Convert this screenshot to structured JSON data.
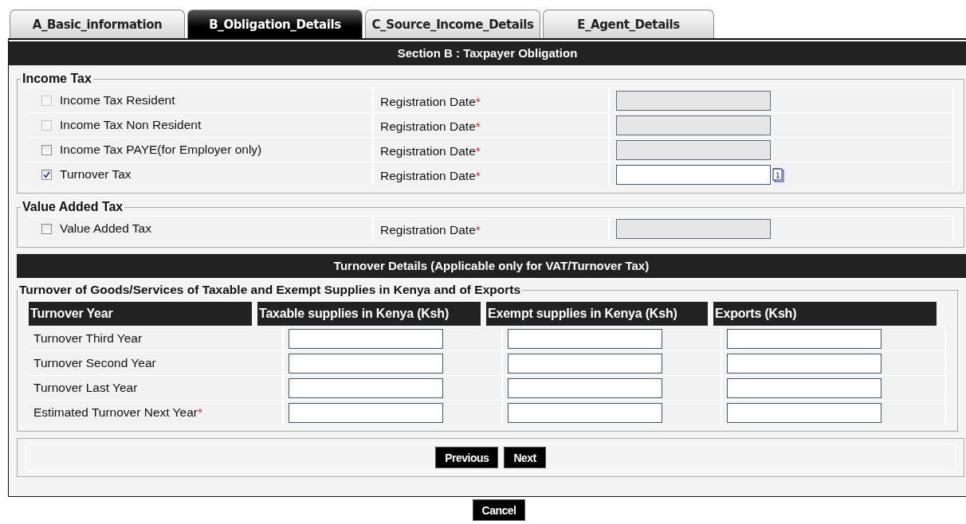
{
  "tabs": [
    {
      "label": "A_Basic_information",
      "selected": false
    },
    {
      "label": "B_Obligation_Details",
      "selected": true
    },
    {
      "label": "C_Source_Income_Details",
      "selected": false
    },
    {
      "label": "E_Agent_Details",
      "selected": false
    }
  ],
  "section_title": "Section B : Taxpayer Obligation",
  "groups": [
    {
      "legend": "Income Tax",
      "rows": [
        {
          "label": "Income Tax Resident",
          "checked": false,
          "disabled": true,
          "date_label": "Registration Date",
          "required_mark": "*",
          "date_disabled": true
        },
        {
          "label": "Income Tax Non Resident",
          "checked": false,
          "disabled": true,
          "date_label": "Registration Date",
          "required_mark": "*",
          "date_disabled": true
        },
        {
          "label": "Income Tax PAYE(for Employer only)",
          "checked": false,
          "disabled": false,
          "date_label": "Registration Date",
          "required_mark": "*",
          "date_disabled": true
        },
        {
          "label": "Turnover Tax",
          "checked": true,
          "disabled": false,
          "date_label": "Registration Date",
          "required_mark": "*",
          "date_disabled": false
        }
      ]
    },
    {
      "legend": "Value Added Tax",
      "rows": [
        {
          "label": "Value Added Tax",
          "checked": false,
          "disabled": false,
          "date_label": "Registration Date",
          "required_mark": "*",
          "date_disabled": true
        }
      ]
    }
  ],
  "turnover": {
    "title": "Turnover Details (Applicable only for VAT/Turnover Tax)",
    "legend": "Turnover of Goods/Services of Taxable and Exempt Supplies in Kenya and of Exports",
    "columns": [
      "Turnover Year",
      "Taxable supplies in Kenya (Ksh)",
      "Exempt supplies in Kenya (Ksh)",
      "Exports (Ksh)"
    ],
    "rows": [
      {
        "label": "Turnover Third Year"
      },
      {
        "label": "Turnover Second Year"
      },
      {
        "label": "Turnover Last Year"
      },
      {
        "label": "Estimated Turnover Next Year",
        "required_mark": "*"
      }
    ]
  },
  "nav_buttons": [
    "Previous",
    "Next"
  ],
  "cancel_button": "Cancel"
}
